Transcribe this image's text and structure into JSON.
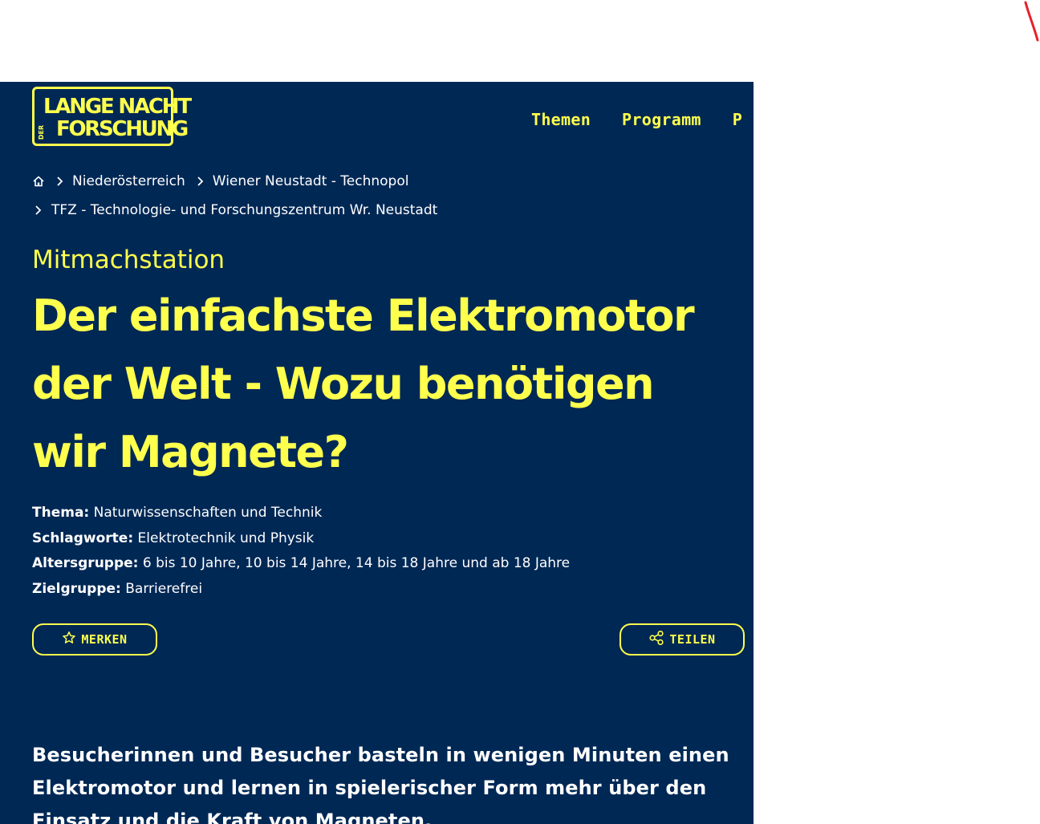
{
  "logo": {
    "line1": "LANGE NACHT",
    "der": "DER",
    "line2": "FORSCHUNG"
  },
  "nav": {
    "items": [
      "Themen",
      "Programm",
      "P"
    ]
  },
  "breadcrumb": {
    "home_icon": "home-icon",
    "items": [
      "Niederösterreich",
      "Wiener Neustadt - Technopol",
      "TFZ - Technologie- und Forschungszentrum Wr. Neustadt"
    ]
  },
  "event": {
    "kicker": "Mitmachstation",
    "title": "Der einfachste Elektromotor der Welt - Wozu benötigen wir Magnete?",
    "meta": [
      {
        "label": "Thema:",
        "value": "Naturwissenschaften und Technik"
      },
      {
        "label": "Schlagworte:",
        "value": "Elektrotechnik und Physik"
      },
      {
        "label": "Altersgruppe:",
        "value": "6 bis 10 Jahre, 10 bis 14 Jahre, 14 bis 18 Jahre und ab 18 Jahre"
      },
      {
        "label": "Zielgruppe:",
        "value": "Barrierefrei"
      }
    ],
    "buttons": {
      "merken": "MERKEN",
      "teilen": "TEILEN"
    },
    "intro": "Besucherinnen und Besucher basteln in wenigen Minuten einen Elektromotor und lernen in spielerischer Form mehr über den Einsatz und die Kraft von Magneten."
  },
  "colors": {
    "background": "#002855",
    "accent": "#ffff4d",
    "text": "#ffffff",
    "mark": "#e8202a"
  }
}
